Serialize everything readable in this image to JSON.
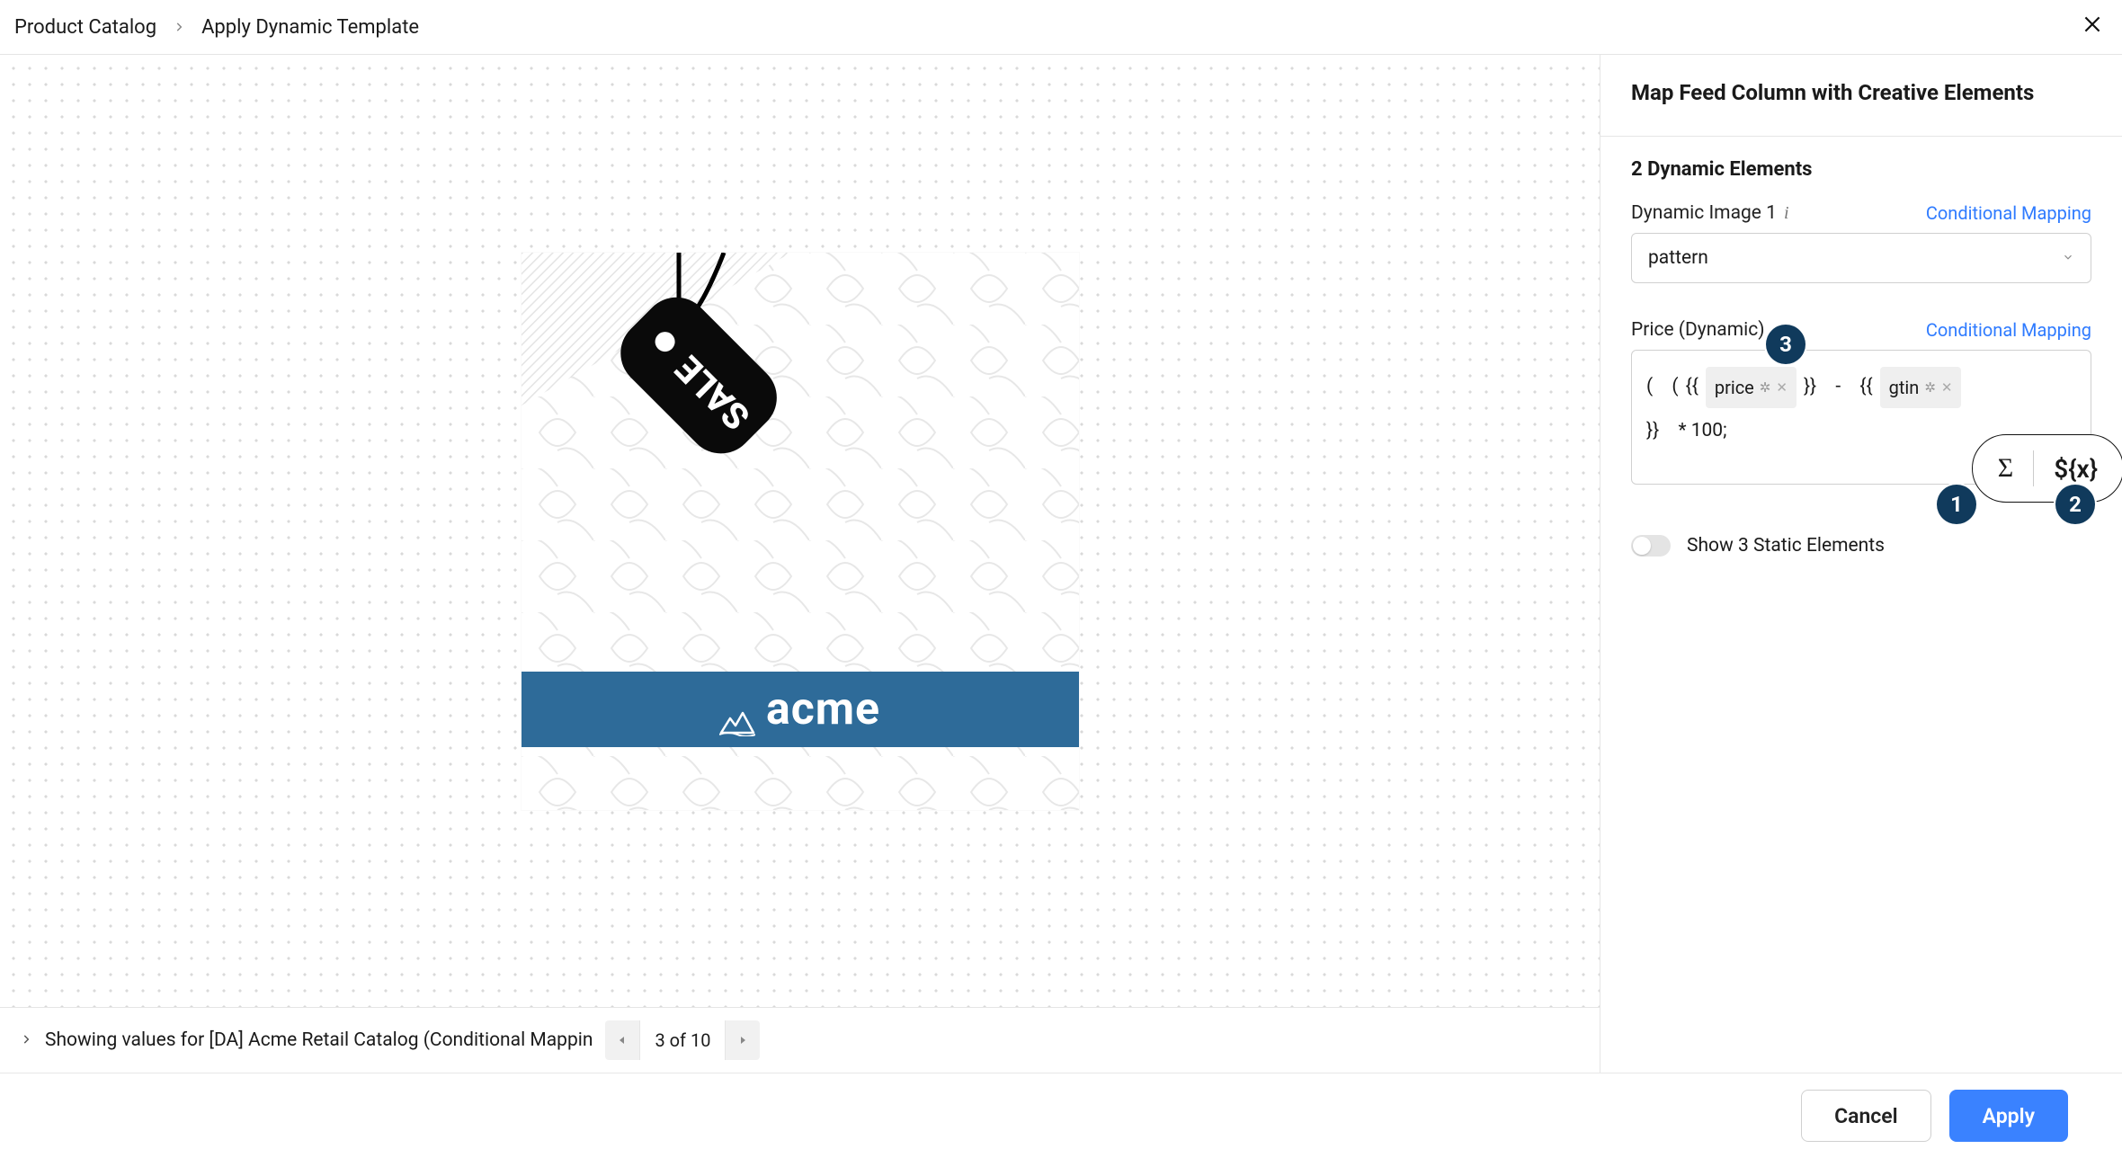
{
  "breadcrumbs": {
    "item1": "Product Catalog",
    "item2": "Apply Dynamic Template"
  },
  "canvas": {
    "tag_text": "SALE",
    "brand_text": "acme",
    "status_text": "Showing values for [DA] Acme Retail Catalog (Conditional Mappin",
    "pager_value": "3 of 10"
  },
  "panel": {
    "title": "Map Feed Column with Creative Elements",
    "section_title": "2 Dynamic Elements",
    "image_field": {
      "label": "Dynamic Image 1",
      "link": "Conditional Mapping",
      "value": "pattern"
    },
    "price_field": {
      "label": "Price (Dynamic)",
      "link": "Conditional Mapping",
      "expr": {
        "open1": "(",
        "open2": "(",
        "dopen1": "{{",
        "token1": "price",
        "dclose1": "}}",
        "minus": "-",
        "dopen2": "{{",
        "token2": "gtin",
        "dclose2": "}}",
        "tail": "*  100;"
      }
    },
    "toolbox": {
      "sigma": "Σ",
      "var": "${x}"
    },
    "static_toggle_label": "Show 3 Static Elements",
    "annotations": {
      "a1": "1",
      "a2": "2",
      "a3": "3"
    }
  },
  "footer": {
    "cancel": "Cancel",
    "apply": "Apply"
  }
}
